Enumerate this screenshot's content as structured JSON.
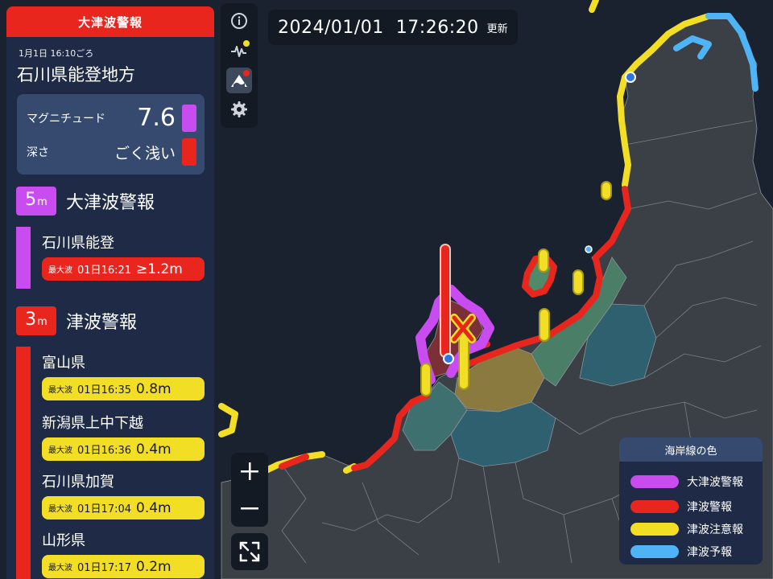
{
  "header": {
    "title": "大津波警報"
  },
  "quake": {
    "time": "1月1日 16:10ごろ",
    "region": "石川県能登地方",
    "magnitude_label": "マグニチュード",
    "magnitude": "7.6",
    "depth_label": "深さ",
    "depth": "ごく浅い"
  },
  "sections": {
    "major": {
      "height": "5",
      "unit": "m",
      "title": "大津波警報",
      "areas": [
        {
          "name": "石川県能登",
          "max_label": "最大波",
          "time": "01日16:21",
          "height": "≥1.2m"
        }
      ]
    },
    "warning": {
      "height": "3",
      "unit": "m",
      "title": "津波警報",
      "areas": [
        {
          "name": "富山県",
          "max_label": "最大波",
          "time": "01日16:35",
          "height": "0.8m"
        },
        {
          "name": "新潟県上中下越",
          "max_label": "最大波",
          "time": "01日16:36",
          "height": "0.4m"
        },
        {
          "name": "石川県加賀",
          "max_label": "最大波",
          "time": "01日17:04",
          "height": "0.4m"
        },
        {
          "name": "山形県",
          "max_label": "最大波",
          "time": "01日17:17",
          "height": "0.2m"
        }
      ]
    }
  },
  "timestamp": {
    "datetime": "2024/01/01  17:26:20",
    "suffix": "更新"
  },
  "toolbar": {
    "buttons": [
      {
        "icon": "info-icon"
      },
      {
        "icon": "waveform-icon",
        "badge_color": "#f3de26"
      },
      {
        "icon": "tsunami-icon",
        "badge_color": "#e8261e",
        "active": true
      },
      {
        "icon": "gear-icon"
      }
    ]
  },
  "zoom": {
    "in_label": "+",
    "out_label": "−"
  },
  "legend": {
    "title": "海岸線の色",
    "items": [
      {
        "label": "大津波警報",
        "color": "#c84cf0"
      },
      {
        "label": "津波警報",
        "color": "#e8261e"
      },
      {
        "label": "津波注意報",
        "color": "#f3de26"
      },
      {
        "label": "津波予報",
        "color": "#4fb4f5"
      }
    ]
  },
  "colors": {
    "major_warning": "#c84cf0",
    "warning": "#e8261e",
    "advisory": "#f3de26",
    "forecast": "#4fb4f5",
    "sea": "#1a2230",
    "land": "#3a4046"
  }
}
